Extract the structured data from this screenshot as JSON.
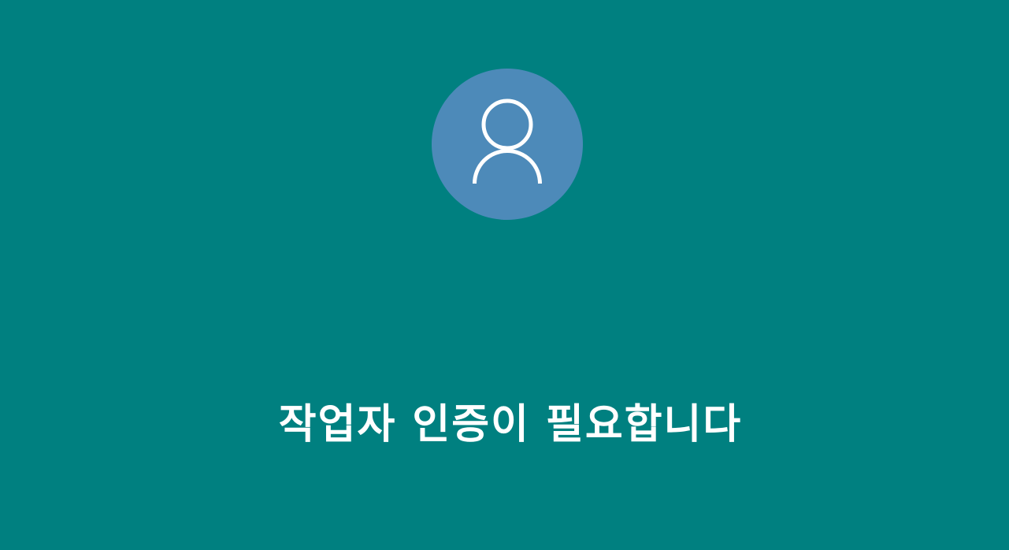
{
  "lock_screen": {
    "background_color": "#008080",
    "avatar": {
      "icon": "user-icon",
      "background_color": "#4d8ab9",
      "icon_color": "#ffffff"
    },
    "message": "작업자 인증이 필요합니다"
  }
}
